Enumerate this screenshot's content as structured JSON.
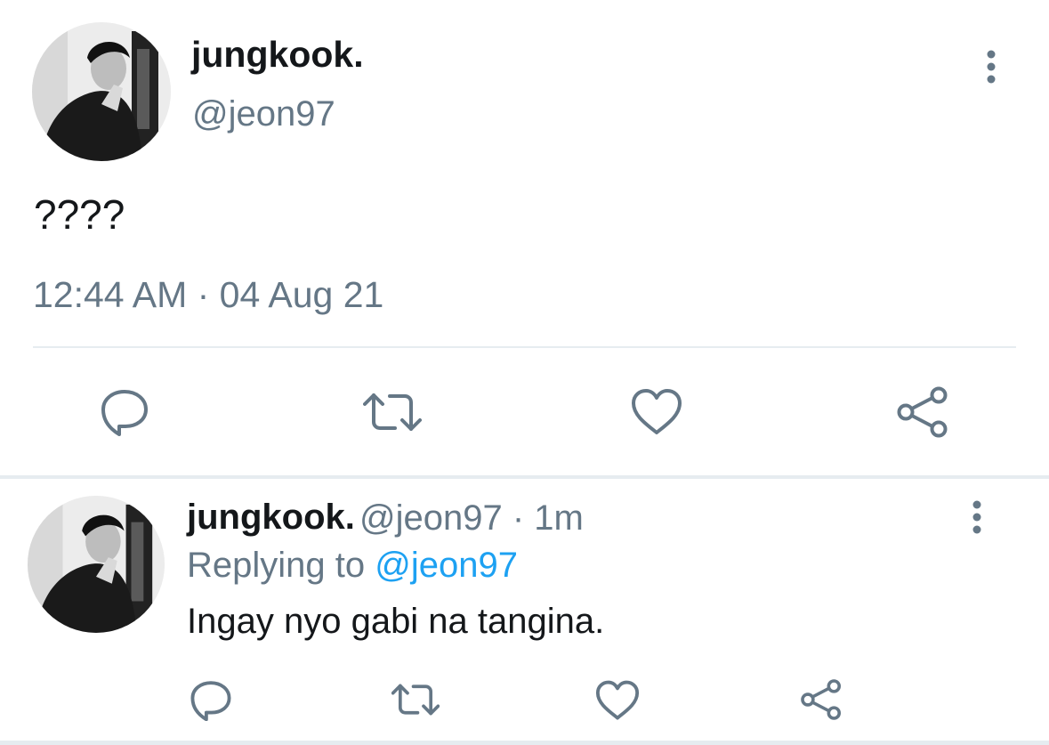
{
  "main_tweet": {
    "display_name": "jungkook.",
    "handle": "@jeon97",
    "text": "????",
    "timestamp": "12:44 AM · 04 Aug 21",
    "more_icon": "more-vertical-icon",
    "actions": [
      "reply-icon",
      "retweet-icon",
      "like-icon",
      "share-icon"
    ]
  },
  "reply_tweet": {
    "display_name": "jungkook.",
    "meta": "@jeon97 · 1m",
    "replying_prefix": "Replying to",
    "replying_mention": "@jeon97",
    "text": "Ingay nyo gabi na tangina.",
    "more_icon": "more-vertical-icon",
    "actions": [
      "reply-icon",
      "retweet-icon",
      "like-icon",
      "share-icon"
    ]
  },
  "colors": {
    "primary_text": "#14171a",
    "secondary_text": "#657786",
    "link": "#1da1f2",
    "divider": "#e6ecf0"
  }
}
